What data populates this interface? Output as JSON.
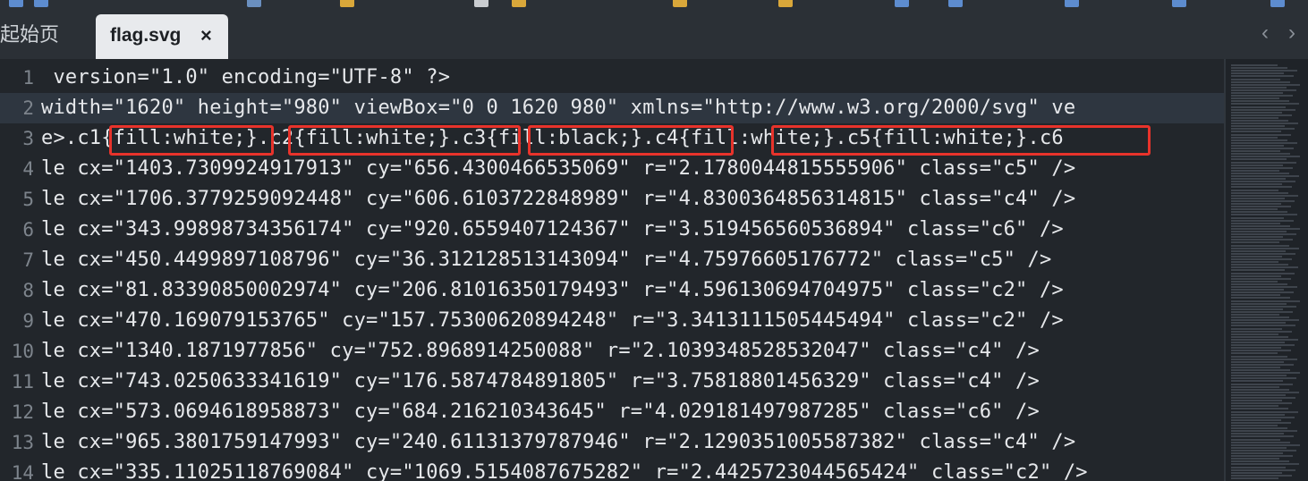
{
  "tabs": {
    "inactive_label": "起始页",
    "active_label": "flag.svg",
    "close_glyph": "×",
    "nav_prev": "‹",
    "nav_next": "›"
  },
  "editor": {
    "active_line": 2,
    "lines": [
      {
        "n": "1",
        "text": " version=\"1.0\" encoding=\"UTF-8\" ?>"
      },
      {
        "n": "2",
        "text": "width=\"1620\" height=\"980\" viewBox=\"0 0 1620 980\" xmlns=\"http://www.w3.org/2000/svg\" ve"
      },
      {
        "n": "3",
        "text": "e>.c1{fill:white;}.c2{fill:white;}.c3{fill:black;}.c4{fill:white;}.c5{fill:white;}.c6"
      },
      {
        "n": "4",
        "text": "le cx=\"1403.7309924917913\" cy=\"656.4300466535069\" r=\"2.1780044815555906\" class=\"c5\" />"
      },
      {
        "n": "5",
        "text": "le cx=\"1706.3779259092448\" cy=\"606.6103722848989\" r=\"4.8300364856314815\" class=\"c4\" />"
      },
      {
        "n": "6",
        "text": "le cx=\"343.99898734356174\" cy=\"920.6559407124367\" r=\"3.519456560536894\" class=\"c6\" />"
      },
      {
        "n": "7",
        "text": "le cx=\"450.4499897108796\" cy=\"36.312128513143094\" r=\"4.75976605176772\" class=\"c5\" />"
      },
      {
        "n": "8",
        "text": "le cx=\"81.83390850002974\" cy=\"206.81016350179493\" r=\"4.596130694704975\" class=\"c2\" />"
      },
      {
        "n": "9",
        "text": "le cx=\"470.169079153765\" cy=\"157.75300620894248\" r=\"3.3413111505445494\" class=\"c2\" />"
      },
      {
        "n": "10",
        "text": "le cx=\"1340.1871977856\" cy=\"752.8968914250088\" r=\"2.1039348528532047\" class=\"c4\" />"
      },
      {
        "n": "11",
        "text": "le cx=\"743.0250633341619\" cy=\"176.5874784891805\" r=\"3.75818801456329\" class=\"c4\" />"
      },
      {
        "n": "12",
        "text": "le cx=\"573.0694618958873\" cy=\"684.216210343645\" r=\"4.029181497987285\" class=\"c6\" />"
      },
      {
        "n": "13",
        "text": "le cx=\"965.3801759147993\" cy=\"240.61131379787946\" r=\"2.1290351005587382\" class=\"c4\" />"
      },
      {
        "n": "14",
        "text": "le cx=\"335.11025118769084\" cy=\"1069.5154087675282\" r=\"2.4425723044565424\" class=\"c2\" />"
      }
    ]
  },
  "colors": {
    "background": "#22262b",
    "active_line": "#2e3640",
    "highlight_box": "#e8332b",
    "tab_active_bg": "#e8eaed"
  },
  "icons": [
    "toolbar-icons",
    "close-icon",
    "chevron-left-icon",
    "chevron-right-icon"
  ]
}
